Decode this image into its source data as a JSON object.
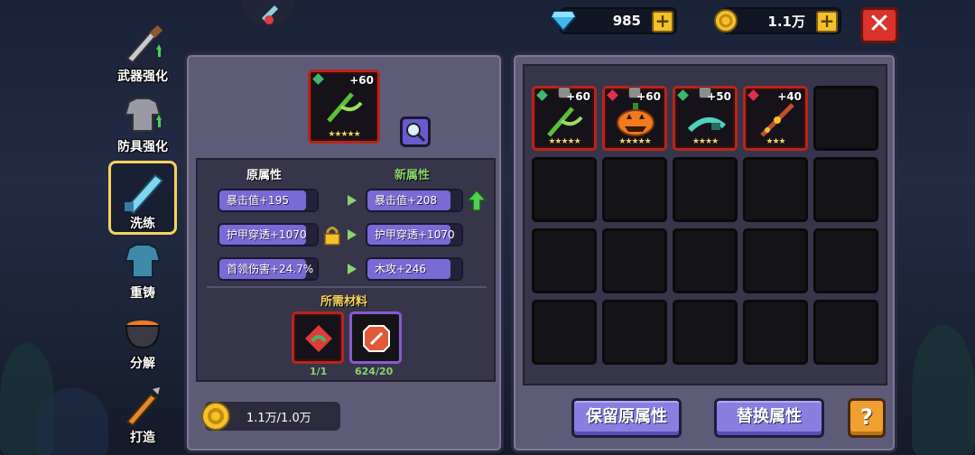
{
  "currency": {
    "gems": "985",
    "gold": "1.1万",
    "plus_symbol": "+"
  },
  "close_symbol": "✕",
  "nav": [
    {
      "label": "武器强化",
      "icon": "sword-upgrade-icon"
    },
    {
      "label": "防具强化",
      "icon": "armor-upgrade-icon"
    },
    {
      "label": "洗练",
      "icon": "refine-sword-icon"
    },
    {
      "label": "重铸",
      "icon": "recast-armor-icon"
    },
    {
      "label": "分解",
      "icon": "cauldron-icon"
    },
    {
      "label": "打造",
      "icon": "forge-sword-icon"
    }
  ],
  "selected_item": {
    "level": "+60",
    "stars": "★★★★★"
  },
  "stats": {
    "old_header": "原属性",
    "new_header": "新属性",
    "old": [
      "暴击值+195",
      "护甲穿透+1070",
      "首领伤害+24.7%"
    ],
    "new": [
      "暴击值+208",
      "护甲穿透+1070",
      "木攻+246"
    ]
  },
  "materials": {
    "header": "所需材料",
    "items": [
      {
        "count": "1/1"
      },
      {
        "count": "624/20"
      }
    ]
  },
  "cost": "1.1万/1.0万",
  "inventory": [
    {
      "level": "+60",
      "stars": "★★★★★",
      "gem": "#3fb86b"
    },
    {
      "level": "+60",
      "stars": "★★★★★",
      "gem": "#e0304a"
    },
    {
      "level": "+50",
      "stars": "★★★★",
      "gem": "#3fb86b"
    },
    {
      "level": "+40",
      "stars": "★★★",
      "gem": "#e0304a"
    }
  ],
  "buttons": {
    "keep": "保留原属性",
    "replace": "替换属性",
    "help": "?"
  },
  "colors": {
    "accent_gold": "#f6d35b",
    "panel": "#5e5b79",
    "button_purple": "#8a7fe0"
  }
}
